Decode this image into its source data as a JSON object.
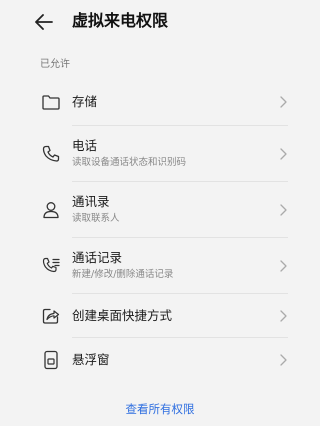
{
  "header": {
    "title": "虚拟来电权限",
    "back_icon": "arrow-left-icon"
  },
  "section": {
    "label": "已允许"
  },
  "permissions": [
    {
      "title": "存储",
      "subtitle": "",
      "icon": "folder-icon"
    },
    {
      "title": "电话",
      "subtitle": "读取设备通话状态和识别码",
      "icon": "phone-icon"
    },
    {
      "title": "通讯录",
      "subtitle": "读取联系人",
      "icon": "contact-icon"
    },
    {
      "title": "通话记录",
      "subtitle": "新建/修改/删除通话记录",
      "icon": "call-log-icon"
    },
    {
      "title": "创建桌面快捷方式",
      "subtitle": "",
      "icon": "shortcut-icon"
    },
    {
      "title": "悬浮窗",
      "subtitle": "",
      "icon": "floating-window-icon"
    }
  ],
  "footer": {
    "link": "查看所有权限"
  },
  "colors": {
    "background": "#f3f3f3",
    "link": "#2f6fe0"
  }
}
